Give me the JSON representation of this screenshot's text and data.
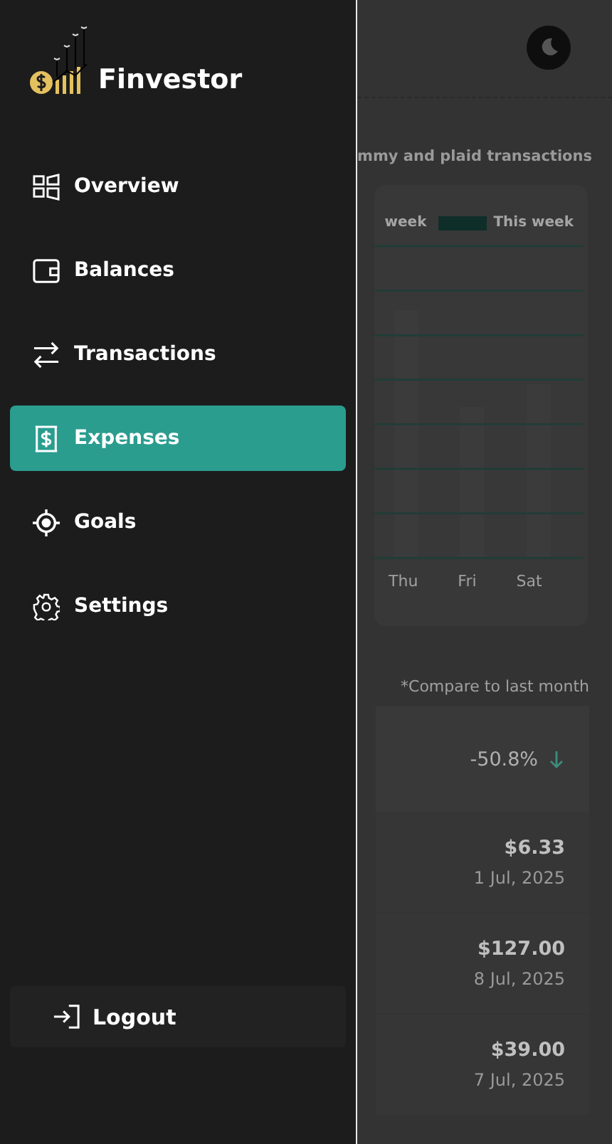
{
  "logo": {
    "name": "Finvestor"
  },
  "nav": [
    {
      "label": "Overview",
      "selected": false
    },
    {
      "label": "Balances",
      "selected": false
    },
    {
      "label": "Transactions",
      "selected": false
    },
    {
      "label": "Expenses",
      "selected": true
    },
    {
      "label": "Goals",
      "selected": false
    },
    {
      "label": "Settings",
      "selected": false
    }
  ],
  "logout": {
    "label": "Logout"
  },
  "page": {
    "subtitle": "mmy and plaid transactions",
    "legend": {
      "previous": "week",
      "current": "This week"
    },
    "chart_labels": [
      "Thu",
      "Fri",
      "Sat"
    ],
    "compare_note": "*Compare to last month",
    "change": {
      "value": "-50.8%"
    },
    "transactions": [
      {
        "amount": "$6.33",
        "date": "1 Jul, 2025"
      },
      {
        "amount": "$127.00",
        "date": "8 Jul, 2025"
      },
      {
        "amount": "$39.00",
        "date": "7 Jul, 2025"
      }
    ]
  }
}
